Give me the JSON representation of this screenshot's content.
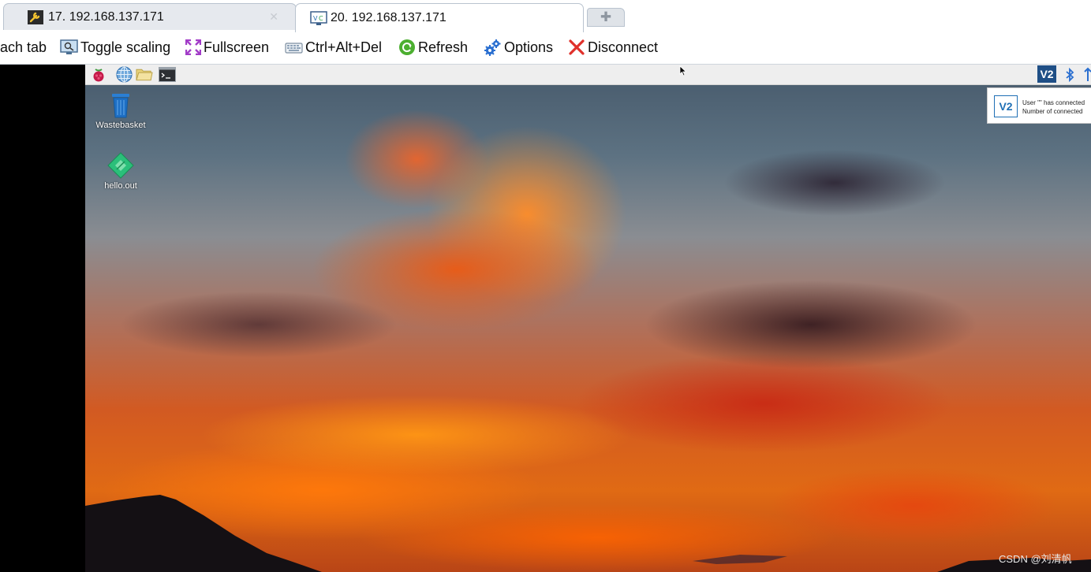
{
  "tabs": [
    {
      "label": "17. 192.168.137.171",
      "icon": "wrench-icon",
      "active": false
    },
    {
      "label": "20. 192.168.137.171",
      "icon": "vnc-monitor-icon",
      "active": true
    }
  ],
  "new_tab_icon": "plus-icon",
  "toolbar": {
    "detach_label": "ach tab",
    "toggle_scaling_label": "Toggle scaling",
    "fullscreen_label": "Fullscreen",
    "cad_label": "Ctrl+Alt+Del",
    "refresh_label": "Refresh",
    "options_label": "Options",
    "disconnect_label": "Disconnect"
  },
  "remote": {
    "taskbar": {
      "icons": [
        "raspberry-menu-icon",
        "web-browser-icon",
        "file-manager-icon",
        "terminal-icon"
      ],
      "tray": [
        "vnc-tray-icon",
        "bluetooth-icon",
        "network-icon"
      ],
      "vnc_tray_text": "V2"
    },
    "desktop_icons": [
      {
        "label": "Wastebasket",
        "icon": "trash-icon"
      },
      {
        "label": "hello.out",
        "icon": "executable-file-icon"
      }
    ],
    "notification": {
      "logo_text": "V2",
      "line1": "User \"\" has connected",
      "line2": "Number of connected"
    },
    "watermark": "CSDN @刘清帆"
  },
  "colors": {
    "tab_border": "#b9c3cf",
    "taskbar_bg": "#eeeeee",
    "vnc_blue": "#1f4f86",
    "refresh_green": "#4caf30",
    "disconnect_red": "#e0302a"
  }
}
